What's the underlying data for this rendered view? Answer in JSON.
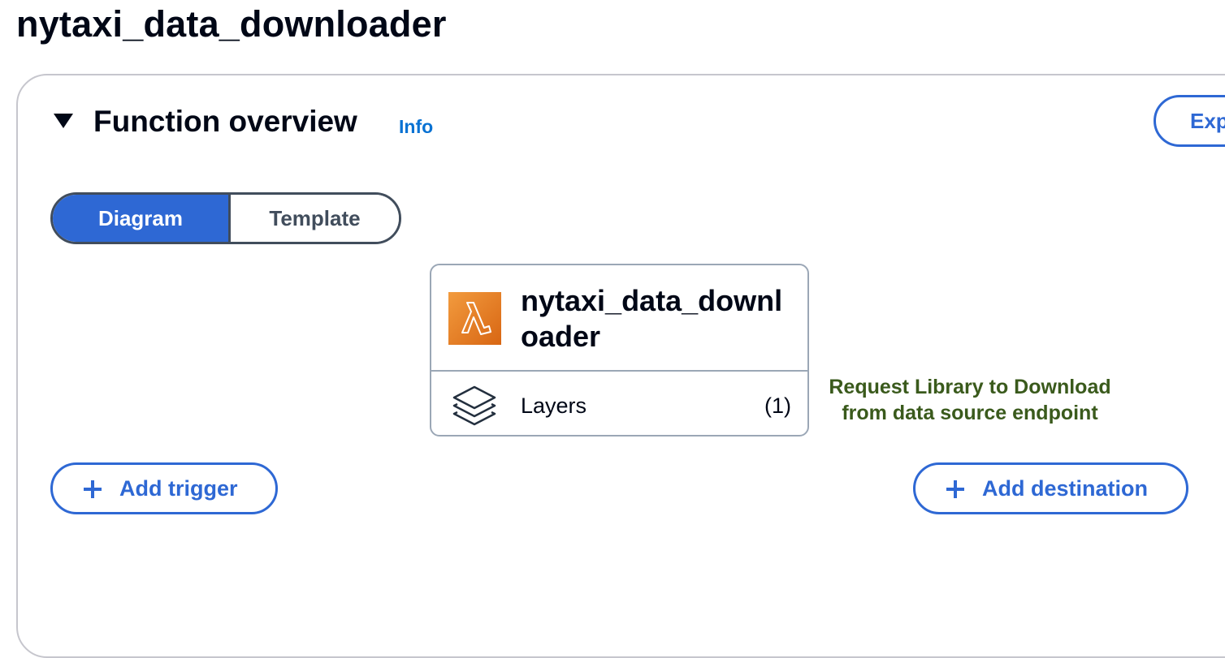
{
  "page": {
    "title": "nytaxi_data_downloader"
  },
  "overview": {
    "title": "Function overview",
    "info_label": "Info",
    "export_label": "Exp"
  },
  "view_toggle": {
    "options": [
      "Diagram",
      "Template"
    ],
    "selected": "Diagram"
  },
  "function_card": {
    "name": "nytaxi_data_downloader",
    "layers_label": "Layers",
    "layers_count": "(1)",
    "icon": "lambda-icon"
  },
  "annotation": {
    "line1": "Request Library to Download",
    "line2": "from data source endpoint",
    "color": "#3a5a1c"
  },
  "actions": {
    "add_trigger": "Add trigger",
    "add_destination": "Add destination"
  },
  "colors": {
    "accent": "#2e68d4",
    "link": "#0972d3",
    "text": "#000716"
  }
}
